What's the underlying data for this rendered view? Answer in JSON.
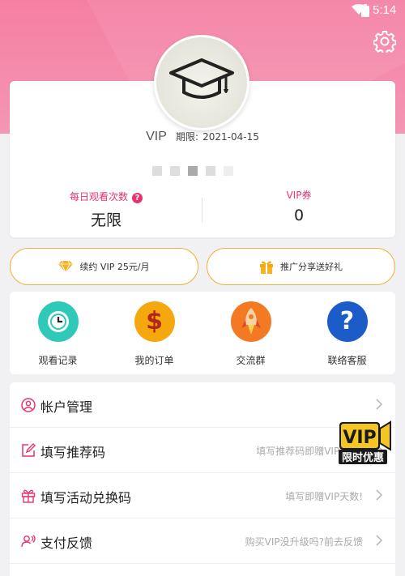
{
  "status_bar": {
    "time": "5:14"
  },
  "profile": {
    "vip_label": "VIP",
    "expire_label": "期限:",
    "expire_date": "2021-04-15"
  },
  "stats": {
    "daily_views_label": "每日观看次数",
    "daily_views_value": "无限",
    "vip_coupon_label": "VIP券",
    "vip_coupon_value": "0"
  },
  "actions": {
    "renew_label": "续约 VIP 25元/月",
    "promote_label": "推广分享送好礼"
  },
  "shortcuts": [
    {
      "label": "观看记录",
      "icon": "clock-icon"
    },
    {
      "label": "我的订单",
      "icon": "dollar-icon"
    },
    {
      "label": "交流群",
      "icon": "rocket-icon"
    },
    {
      "label": "联络客服",
      "icon": "question-icon"
    }
  ],
  "menu": [
    {
      "label": "帐户管理",
      "hint": "",
      "icon": "user-icon"
    },
    {
      "label": "填写推荐码",
      "hint": "填写推荐码即赠VIP天数!",
      "icon": "edit-icon"
    },
    {
      "label": "填写活动兑换码",
      "hint": "填写即赠VIP天数!",
      "icon": "gift-icon"
    },
    {
      "label": "支付反馈",
      "hint": "购买VIP没升级吗?前去反馈",
      "icon": "feedback-icon"
    }
  ],
  "promo_badge": {
    "line1": "VIP",
    "line2": "限时优惠"
  },
  "colors": {
    "header_pink": "#f57fa3",
    "accent_pink": "#e8336e",
    "pill_border": "#f2b13d",
    "shortcut_teal": "#2fc9b9",
    "shortcut_gold": "#f5a70e",
    "shortcut_orange": "#f37a22",
    "shortcut_blue": "#1c5cc8"
  }
}
